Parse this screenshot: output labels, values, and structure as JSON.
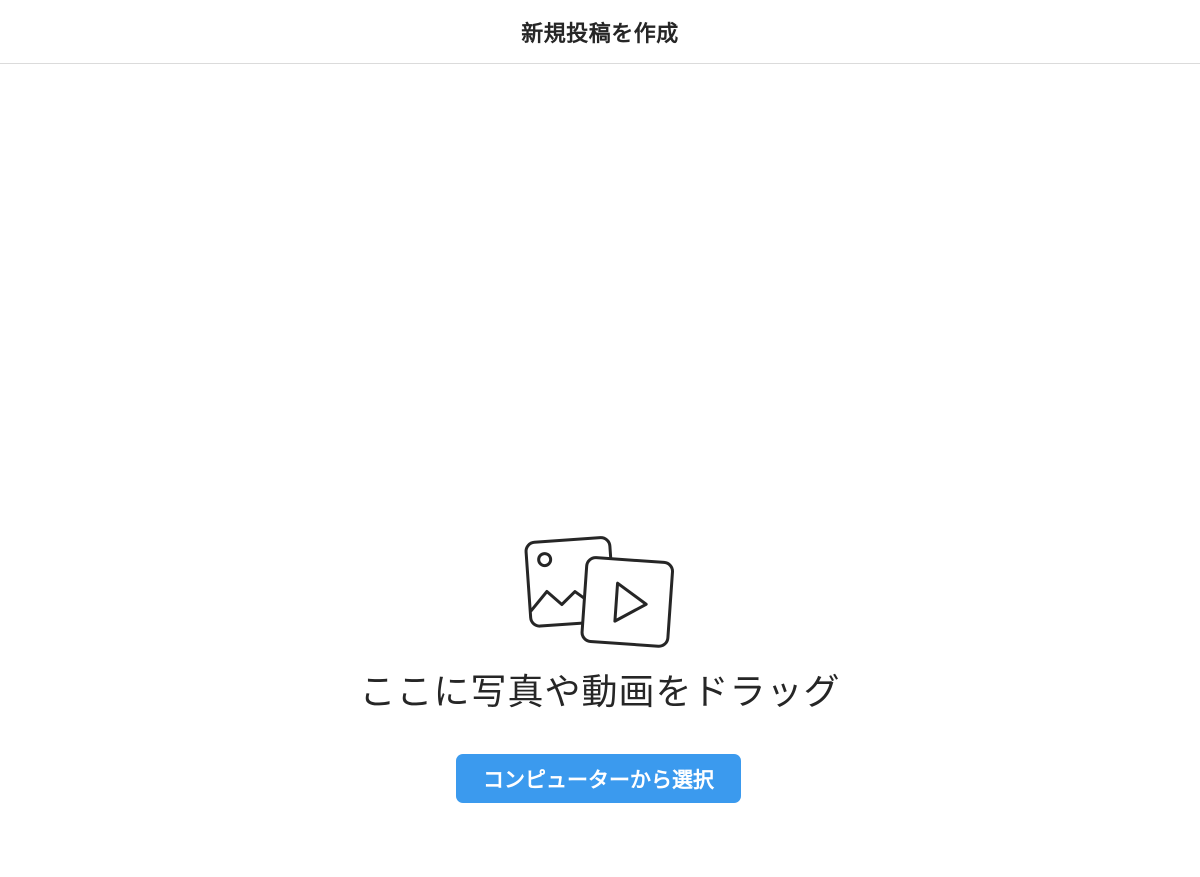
{
  "dialog": {
    "title": "新規投稿を作成",
    "icon": "photo-video-icon",
    "drop_prompt": "ここに写真や動画をドラッグ",
    "select_button_label": "コンピューターから選択"
  },
  "colors": {
    "accent": "#3b9aee",
    "text": "#262626",
    "divider": "#dbdbdb",
    "background": "#ffffff"
  }
}
